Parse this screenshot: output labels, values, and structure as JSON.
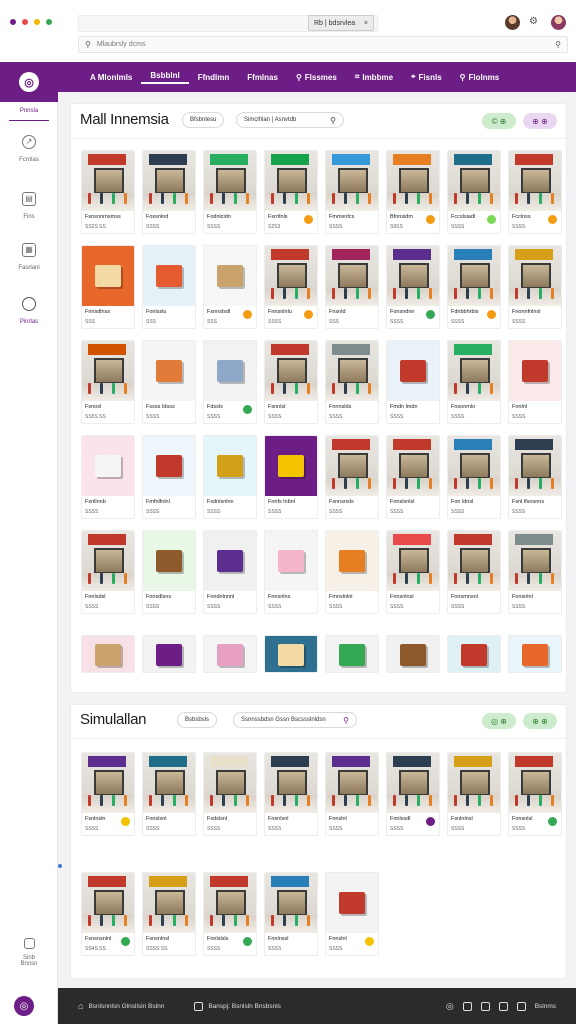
{
  "header": {
    "logo_colors": [
      "#6d1e86",
      "#e84a4a",
      "#f4b400",
      "#34a853"
    ],
    "tab_label": "Rb | bdsrvlea",
    "tab_close": "×",
    "search_placeholder": "Mlaubrsly dcms"
  },
  "sidebar": {
    "items": [
      {
        "label": "Pnnsla",
        "icon": "store-icon"
      },
      {
        "label": "Fcrnlas",
        "icon": "compass-icon"
      },
      {
        "label": "Fins",
        "icon": "chart-icon"
      },
      {
        "label": "Fasrlani",
        "icon": "calendar-icon"
      },
      {
        "label": "Pinrlas",
        "icon": "chat-icon"
      }
    ],
    "bottom_item": "Sinb Bnnsn"
  },
  "nav": {
    "items": [
      {
        "label": "A Mlonlmls",
        "active": false,
        "icon": "mall-icon"
      },
      {
        "label": "Bsbblnl",
        "active": true,
        "icon": ""
      },
      {
        "label": "Ffndlmn",
        "active": false,
        "icon": ""
      },
      {
        "label": "Ffmlnas",
        "active": false,
        "icon": ""
      },
      {
        "label": "Flssmes",
        "active": false,
        "icon": "search-icon"
      },
      {
        "label": "Imbbme",
        "active": false,
        "icon": "tag-icon"
      },
      {
        "label": "Fisnls",
        "active": false,
        "icon": "pin-icon"
      },
      {
        "label": "Flolnms",
        "active": false,
        "icon": "search-icon"
      }
    ]
  },
  "section1": {
    "title": "Mall Innemsia",
    "pill": "Bfsbnlesu",
    "search": "Simclhlan | Asnvtdb",
    "ctrl1": "© ⊕",
    "ctrl2": "⊕ ⊕",
    "cards": [
      {
        "name": "Fsnsnnrnsmss",
        "price": "SS2S SS",
        "kind": "store",
        "sign": "#c0392b",
        "badge": ""
      },
      {
        "name": "Foxsnlnd",
        "price": "SSSS",
        "kind": "store",
        "sign": "#2c3e50",
        "badge": ""
      },
      {
        "name": "Fodnlcidn",
        "price": "SSSS",
        "kind": "store",
        "sign": "#27ae60",
        "badge": ""
      },
      {
        "name": "Fsrrtlnls",
        "price": "S2S3",
        "kind": "store",
        "sign": "#16a34a",
        "badge": "#f39c12"
      },
      {
        "name": "Fmmsnfcs",
        "price": "SSSS",
        "kind": "store",
        "sign": "#3498db",
        "badge": ""
      },
      {
        "name": "Bfnnsidm",
        "price": "S9SS",
        "kind": "store",
        "sign": "#e67e22",
        "badge": "#f39c12"
      },
      {
        "name": "Fccslsiadl",
        "price": "SSSS",
        "kind": "store",
        "sign": "#1f6f8b",
        "badge": "#7ed957"
      },
      {
        "name": "Fcclnss",
        "price": "SSSS",
        "kind": "store",
        "sign": "#c0392b",
        "badge": "#f39c12"
      },
      {
        "name": "Fnnsdlnss",
        "price": "SSS",
        "kind": "obj",
        "bg": "#e8672a",
        "obj": "#f3d9a4",
        "badge": ""
      },
      {
        "name": "Fonlsslu",
        "price": "SSS",
        "kind": "obj",
        "bg": "#e6f0f7",
        "obj": "#e45b2f",
        "badge": ""
      },
      {
        "name": "Fsnnslsdl",
        "price": "SSS",
        "kind": "obj",
        "bg": "#f6f6f6",
        "obj": "#c9a36b",
        "badge": "#f39c12"
      },
      {
        "name": "Fnnsnlnlu",
        "price": "SSSS",
        "kind": "store",
        "sign": "#c0392b",
        "badge": "#f39c12"
      },
      {
        "name": "Fnsnld",
        "price": "SSS",
        "kind": "store",
        "sign": "#a3245a",
        "badge": ""
      },
      {
        "name": "Fonsndnn",
        "price": "SSSS",
        "kind": "store",
        "sign": "#5b2d8e",
        "badge": "#34a853"
      },
      {
        "name": "Fdnbbhrbis",
        "price": "SSSS",
        "kind": "store",
        "sign": "#2980b9",
        "badge": "#f39c12"
      },
      {
        "name": "Fnonnfnlnsl",
        "price": "SSSS",
        "kind": "store",
        "sign": "#d4a017",
        "badge": ""
      },
      {
        "name": "Fsnosl",
        "price": "SS5S SS",
        "kind": "store",
        "sign": "#d35400",
        "badge": ""
      },
      {
        "name": "Fssss Idsss",
        "price": "SSSS",
        "kind": "obj",
        "bg": "#f5f5f5",
        "obj": "#e07b39",
        "badge": ""
      },
      {
        "name": "Fdssls",
        "price": "SSSS",
        "kind": "obj",
        "bg": "#f2f2f2",
        "obj": "#8fa8c8",
        "badge": "#34a853"
      },
      {
        "name": "Fsnnlsl",
        "price": "SSSS",
        "kind": "store",
        "sign": "#c0392b",
        "badge": ""
      },
      {
        "name": "Fnnnslds",
        "price": "SSSS",
        "kind": "store",
        "sign": "#7f8c8d",
        "badge": ""
      },
      {
        "name": "Fmdn lmdn",
        "price": "SSSS",
        "kind": "obj",
        "bg": "#e9f2f9",
        "obj": "#c0392b",
        "badge": ""
      },
      {
        "name": "Fnsonmlo",
        "price": "SSSS",
        "kind": "store",
        "sign": "#27ae60",
        "badge": ""
      },
      {
        "name": "Fnnlnl",
        "price": "SSSS",
        "kind": "obj",
        "bg": "#fbe9e9",
        "obj": "#c0392b",
        "badge": ""
      },
      {
        "name": "Fsnllnnb",
        "price": "SSSS",
        "kind": "obj",
        "bg": "#fbe3ea",
        "obj": "#f5f5f5",
        "badge": ""
      },
      {
        "name": "Fmfnlfnlnl",
        "price": "SSSS",
        "kind": "obj",
        "bg": "#eef6fb",
        "obj": "#c0392b",
        "badge": ""
      },
      {
        "name": "Fsdnlsnlnn",
        "price": "SSSS",
        "kind": "obj",
        "bg": "#e5f6fb",
        "obj": "#d4a017",
        "badge": ""
      },
      {
        "name": "Fnnfs lnbnl",
        "price": "SSSS",
        "kind": "obj",
        "bg": "#6d1e86",
        "obj": "#f3c300",
        "badge": ""
      },
      {
        "name": "Fsnnsnsls",
        "price": "SSSS",
        "kind": "store",
        "sign": "#c0392b",
        "badge": ""
      },
      {
        "name": "Fnnslsnlsl",
        "price": "SSSS",
        "kind": "store",
        "sign": "#c0392b",
        "badge": ""
      },
      {
        "name": "Fon ldnsl",
        "price": "SSSS",
        "kind": "store",
        "sign": "#2980b9",
        "badge": ""
      },
      {
        "name": "Fsnl lfsnsnns",
        "price": "SSSS",
        "kind": "store",
        "sign": "#2c3e50",
        "badge": ""
      },
      {
        "name": "Fnnlsdsl",
        "price": "SSSS",
        "kind": "store",
        "sign": "#c0392b",
        "badge": ""
      },
      {
        "name": "Fnnsdlsns",
        "price": "SSSS",
        "kind": "obj",
        "bg": "#e9f7e6",
        "obj": "#8e5a2b",
        "badge": ""
      },
      {
        "name": "Fnndnlnnnl",
        "price": "SSSS",
        "kind": "obj",
        "bg": "#f0f0f0",
        "obj": "#5b2d8e",
        "badge": ""
      },
      {
        "name": "Fnnsnlns",
        "price": "SSSS",
        "kind": "obj",
        "bg": "#f5f5f5",
        "obj": "#f4b6c8",
        "badge": ""
      },
      {
        "name": "Fmnslnlnl",
        "price": "SSSS",
        "kind": "obj",
        "bg": "#f7f0e6",
        "obj": "#e67e22",
        "badge": ""
      },
      {
        "name": "Fnnsnlnsl",
        "price": "SSSS",
        "kind": "store",
        "sign": "#e84a4a",
        "badge": ""
      },
      {
        "name": "Fnnsmnsnl",
        "price": "SSSS",
        "kind": "store",
        "sign": "#c0392b",
        "badge": ""
      },
      {
        "name": "Fnnsnlnl",
        "price": "SSSS",
        "kind": "store",
        "sign": "#7f8c8d",
        "badge": ""
      }
    ],
    "partial_row": [
      {
        "bg": "#f7e1e6",
        "obj": "#c9a36b"
      },
      {
        "bg": "#f2f2f2",
        "obj": "#6d1e86"
      },
      {
        "bg": "#f5f5f5",
        "obj": "#e8a0c2"
      },
      {
        "bg": "#2f6f8f",
        "obj": "#f3d9a4"
      },
      {
        "bg": "#f3f3f3",
        "obj": "#34a853"
      },
      {
        "bg": "#f1f1f1",
        "obj": "#8e5a2b"
      },
      {
        "bg": "#dff1f5",
        "obj": "#c0392b"
      },
      {
        "bg": "#eaf4fb",
        "obj": "#e8672a"
      }
    ]
  },
  "section2": {
    "title": "Simulallan",
    "pill": "Bsbsbsls",
    "search": "Ssnnssbdsn Gssn Bscssslnldsn",
    "ctrl1": "◎ ⊕",
    "ctrl2": "⊕ ⊕",
    "row1": [
      {
        "name": "Fsnlnsln",
        "price": "SSSS",
        "sign": "#5b2d8e",
        "badge": "#f3c300"
      },
      {
        "name": "Fnnslsnl",
        "price": "SSSS",
        "sign": "#1f6f8b",
        "badge": ""
      },
      {
        "name": "Fsdslsnl",
        "price": "SSSS",
        "sign": "#e8e0c8",
        "badge": ""
      },
      {
        "name": "Fnsnlsnl",
        "price": "SSSS",
        "sign": "#2c3e50",
        "badge": ""
      },
      {
        "name": "Fnnslnl",
        "price": "SSSS",
        "sign": "#5b2d8e",
        "badge": ""
      },
      {
        "name": "Fnnlssdl",
        "price": "SSSS",
        "sign": "#2c3e50",
        "badge": "#6d1e86"
      },
      {
        "name": "Fsnlnlnsl",
        "price": "SSSS",
        "sign": "#d4a017",
        "badge": ""
      },
      {
        "name": "Fnnsnlsl",
        "price": "SSSS",
        "sign": "#c0392b",
        "badge": "#34a853"
      }
    ],
    "row2": [
      {
        "name": "Fsnsnsnlnl",
        "price": "SS4S SS",
        "kind": "store",
        "sign": "#c0392b",
        "badge": "#34a853"
      },
      {
        "name": "Fsnsnlnsl",
        "price": "SSSS SS",
        "kind": "store",
        "sign": "#d4a017",
        "badge": ""
      },
      {
        "name": "Fnnlslsls",
        "price": "SSSS",
        "kind": "store",
        "sign": "#c0392b",
        "badge": "#34a853"
      },
      {
        "name": "Fnnlnssl",
        "price": "SSSS",
        "kind": "store",
        "sign": "#2980b9",
        "badge": ""
      },
      {
        "name": "Fnnslnl",
        "price": "SSSS",
        "kind": "obj",
        "bg": "#f3f3f3",
        "obj": "#c0392b",
        "badge": "#f3c300"
      }
    ]
  },
  "footer": {
    "left": "Bsnlsnnlsn Glnsllsln Bslnn",
    "mid": "Banspj: Bsnlsln Bnsbsnls",
    "right": "Bslnms"
  }
}
